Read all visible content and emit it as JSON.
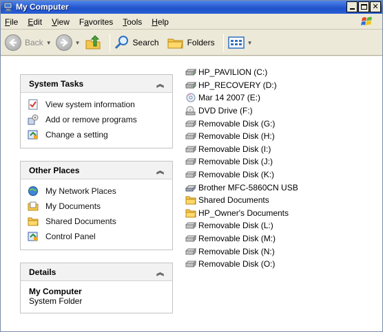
{
  "window": {
    "title": "My Computer"
  },
  "menu": [
    {
      "label": "File",
      "u": "F",
      "rest": "ile"
    },
    {
      "label": "Edit",
      "u": "E",
      "rest": "dit"
    },
    {
      "label": "View",
      "u": "V",
      "rest": "iew"
    },
    {
      "label": "Favorites",
      "pre": "F",
      "u": "a",
      "rest": "vorites"
    },
    {
      "label": "Tools",
      "u": "T",
      "rest": "ools"
    },
    {
      "label": "Help",
      "u": "H",
      "rest": "elp"
    }
  ],
  "toolbar": {
    "back_label": "Back",
    "search_label": "Search",
    "folders_label": "Folders"
  },
  "system_tasks": {
    "title": "System Tasks",
    "items": [
      {
        "label": "View system information",
        "icon": "system-info-icon"
      },
      {
        "label": "Add or remove programs",
        "icon": "add-remove-programs-icon"
      },
      {
        "label": "Change a setting",
        "icon": "control-panel-icon"
      }
    ]
  },
  "other_places": {
    "title": "Other Places",
    "items": [
      {
        "label": "My Network Places",
        "icon": "network-places-icon"
      },
      {
        "label": "My Documents",
        "icon": "my-documents-icon"
      },
      {
        "label": "Shared Documents",
        "icon": "folder-icon"
      },
      {
        "label": "Control Panel",
        "icon": "control-panel-icon"
      }
    ]
  },
  "details": {
    "title": "Details",
    "name": "My Computer",
    "type": "System Folder"
  },
  "drives": [
    {
      "label": "HP_PAVILION (C:)",
      "icon": "hard-disk-icon"
    },
    {
      "label": "HP_RECOVERY (D:)",
      "icon": "hard-disk-icon"
    },
    {
      "label": "Mar 14 2007 (E:)",
      "icon": "cd-icon"
    },
    {
      "label": "DVD Drive (F:)",
      "icon": "dvd-drive-icon"
    },
    {
      "label": "Removable Disk (G:)",
      "icon": "removable-disk-icon"
    },
    {
      "label": "Removable Disk (H:)",
      "icon": "removable-disk-icon"
    },
    {
      "label": "Removable Disk (I:)",
      "icon": "removable-disk-icon"
    },
    {
      "label": "Removable Disk (J:)",
      "icon": "removable-disk-icon"
    },
    {
      "label": "Removable Disk (K:)",
      "icon": "removable-disk-icon"
    },
    {
      "label": "Brother MFC-5860CN USB",
      "icon": "scanner-icon"
    },
    {
      "label": "Shared Documents",
      "icon": "folder-icon"
    },
    {
      "label": "HP_Owner's Documents",
      "icon": "folder-icon"
    },
    {
      "label": "Removable Disk (L:)",
      "icon": "removable-disk-icon"
    },
    {
      "label": "Removable Disk (M:)",
      "icon": "removable-disk-icon"
    },
    {
      "label": "Removable Disk (N:)",
      "icon": "removable-disk-icon"
    },
    {
      "label": "Removable Disk (O:)",
      "icon": "removable-disk-icon"
    }
  ]
}
